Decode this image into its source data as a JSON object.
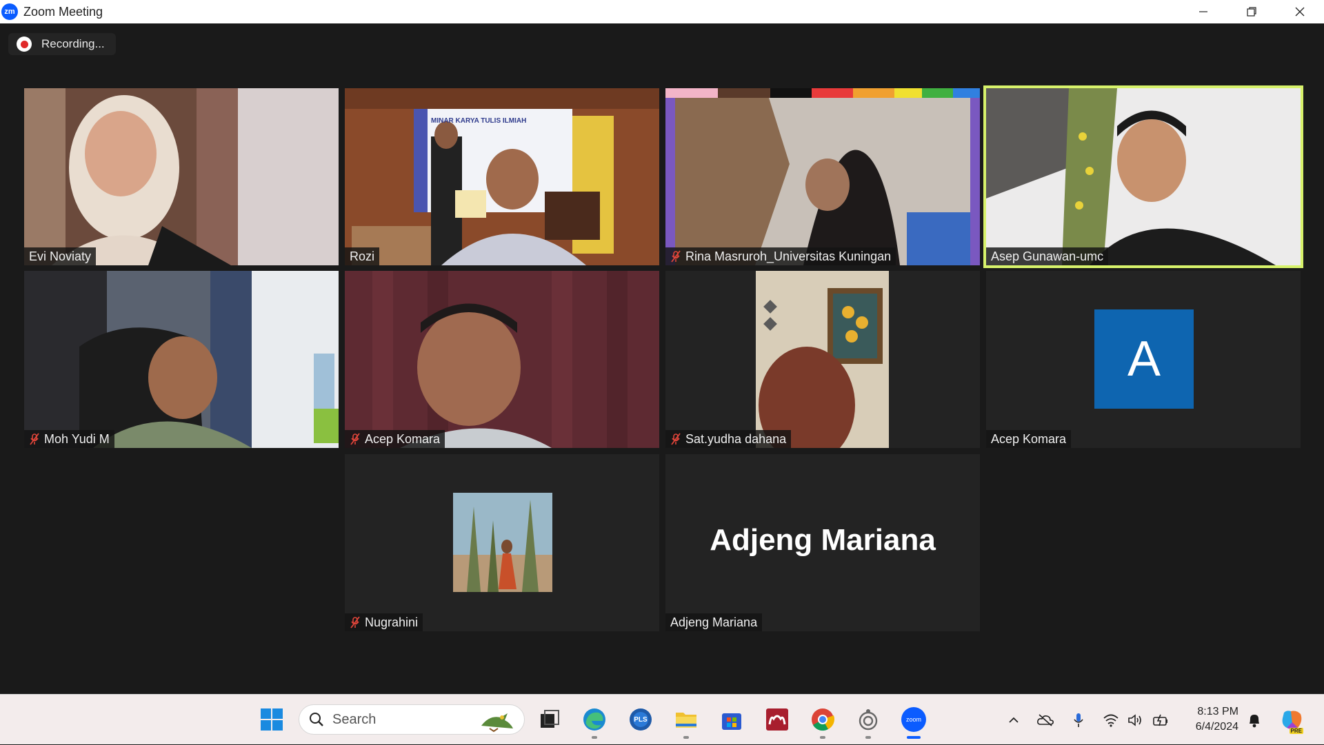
{
  "window": {
    "title": "Zoom Meeting",
    "logo_text": "zm",
    "minimize_icon": "minimize-icon",
    "restore_icon": "restore-icon",
    "close_icon": "close-icon"
  },
  "recording": {
    "label": "Recording..."
  },
  "participants": [
    {
      "name": "Evi  Noviaty",
      "muted": false,
      "active": false
    },
    {
      "name": "Rozi",
      "muted": false,
      "active": false
    },
    {
      "name": "Rina Masruroh_Universitas Kuningan",
      "muted": true,
      "active": false
    },
    {
      "name": "Asep Gunawan-umc",
      "muted": false,
      "active": true
    },
    {
      "name": "Moh Yudi M",
      "muted": true,
      "active": false
    },
    {
      "name": "Acep Komara",
      "muted": true,
      "active": false
    },
    {
      "name": "Sat.yudha dahana",
      "muted": true,
      "active": false
    },
    {
      "name": "Acep Komara",
      "muted": false,
      "active": false,
      "avatar_letter": "A"
    },
    {
      "name": "Nugrahini",
      "muted": true,
      "active": false
    },
    {
      "name": "Adjeng Mariana",
      "muted": false,
      "active": false,
      "display_name": "Adjeng Mariana"
    }
  ],
  "video_content": {
    "banner_title": "MINAR KARYA TULIS ILMIAH"
  },
  "taskbar": {
    "search_placeholder": "Search",
    "clock_time": "8:13 PM",
    "clock_date": "6/4/2024",
    "pls_label": "PLS",
    "zoom_label": "zoom",
    "pre_label": "PRE",
    "accent_color": "#0b5cff"
  }
}
